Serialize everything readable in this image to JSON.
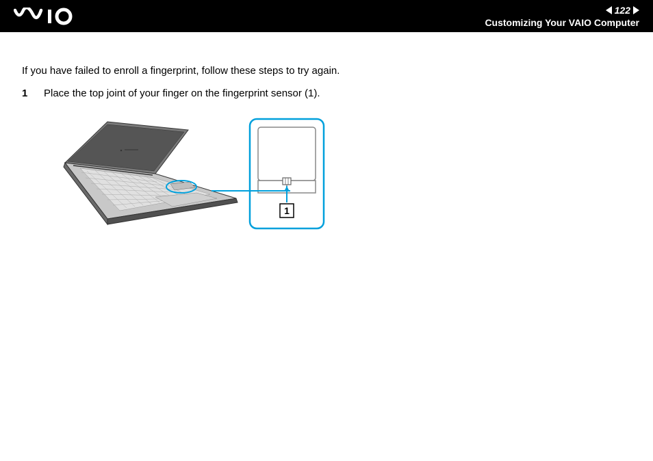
{
  "header": {
    "page_number": "122",
    "section_title": "Customizing Your VAIO Computer"
  },
  "content": {
    "intro": "If you have failed to enroll a fingerprint, follow these steps to try again.",
    "step_number": "1",
    "step_text": "Place the top joint of your finger on the fingerprint sensor (1).",
    "callout_label": "1"
  }
}
